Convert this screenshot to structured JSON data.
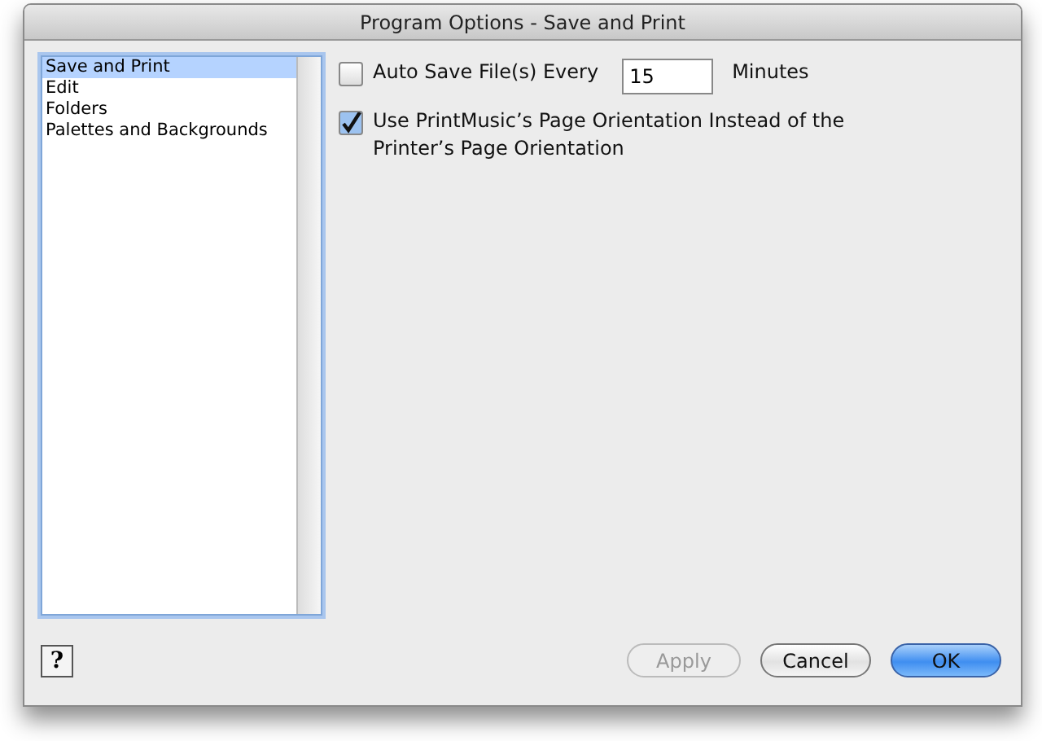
{
  "window": {
    "title": "Program Options - Save and Print"
  },
  "sidebar": {
    "items": [
      {
        "label": "Save and Print",
        "selected": true
      },
      {
        "label": "Edit",
        "selected": false
      },
      {
        "label": "Folders",
        "selected": false
      },
      {
        "label": "Palettes and Backgrounds",
        "selected": false
      }
    ]
  },
  "auto_save": {
    "label": "Auto Save File(s) Every",
    "checked": false,
    "value": "15",
    "unit": "Minutes"
  },
  "orientation": {
    "label": "Use PrintMusic’s Page Orientation Instead of the Printer’s Page Orientation",
    "checked": true
  },
  "help": {
    "label": "?"
  },
  "buttons": [
    {
      "label": "Apply",
      "disabled": true,
      "default": false
    },
    {
      "label": "Cancel",
      "disabled": false,
      "default": false
    },
    {
      "label": "OK",
      "disabled": false,
      "default": true
    }
  ]
}
